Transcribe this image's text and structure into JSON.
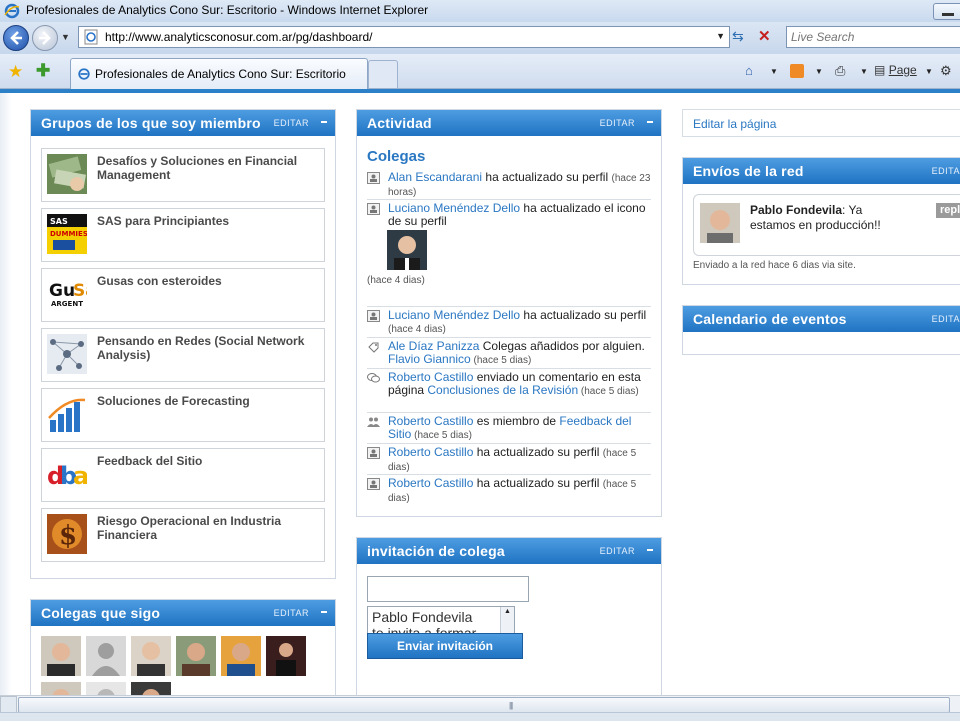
{
  "window": {
    "title": "Profesionales de Analytics Cono Sur: Escritorio - Windows Internet Explorer"
  },
  "address": {
    "url": "http://www.analyticsconosur.com.ar/pg/dashboard/",
    "search_placeholder": "Live Search"
  },
  "tabbar": {
    "tab_title": "Profesionales de Analytics Cono Sur: Escritorio",
    "page_label": "Page"
  },
  "groups_widget": {
    "title": "Grupos de los que soy miembro",
    "edit": "EDITAR",
    "items": [
      {
        "name": "Desafíos y Soluciones en Financial Management",
        "thumb": "money-thumb"
      },
      {
        "name": "SAS para Principiantes",
        "thumb": "sas-book-thumb",
        "thumb_text": "SAS DUMMIES"
      },
      {
        "name": "Gusas con esteroides",
        "thumb": "gusas-logo-thumb",
        "thumb_text": "GuSa",
        "thumb_sub": "ARGENT"
      },
      {
        "name": "Pensando en Redes (Social Network Analysis)",
        "thumb": "network-thumb"
      },
      {
        "name": "Soluciones de Forecasting",
        "thumb": "forecast-chart-thumb"
      },
      {
        "name": "Feedback del Sitio",
        "thumb": "feedback-logo-thumb",
        "thumb_text": "dba"
      },
      {
        "name": "Riesgo Operacional en Industria Financiera",
        "thumb": "dollar-thumb",
        "thumb_text": "$"
      }
    ]
  },
  "colegas_widget": {
    "title": "Colegas que sigo",
    "edit": "EDITAR"
  },
  "actividad_widget": {
    "title": "Actividad",
    "edit": "EDITAR",
    "subtitle": "Colegas",
    "entries": [
      {
        "icon": "profile-icon",
        "who": "Alan Escandarani",
        "text": " ha actualizado su perfil ",
        "when": "(hace 23 horas)"
      },
      {
        "icon": "profile-icon",
        "who": "Luciano Menéndez Dello",
        "text": " ha actualizado el icono de su perfil",
        "when": "(hace 4 dias)"
      },
      {
        "icon": "profile-icon",
        "who": "Luciano Menéndez Dello",
        "text": " ha actualizado su perfil ",
        "when": "(hace 4 dias)"
      },
      {
        "icon": "tag-icon",
        "who": "Ale Díaz Panizza",
        "text": " Colegas añadidos por alguien. ",
        "who2": "Flavio Giannico",
        "when": " (hace 5 dias)"
      },
      {
        "icon": "comment-icon",
        "who": "Roberto Castillo",
        "text": " enviado un comentario en esta página ",
        "who2": "Conclusiones de la Revisión",
        "when": " (hace 5 dias)"
      },
      {
        "icon": "group-icon",
        "who": "Roberto Castillo",
        "text": " es miembro de ",
        "who2": "Feedback del Sitio",
        "when": " (hace 5 dias)"
      },
      {
        "icon": "profile-icon",
        "who": "Roberto Castillo",
        "text": " ha actualizado su perfil ",
        "when": "(hace 5 dias)"
      },
      {
        "icon": "profile-icon",
        "who": "Roberto Castillo",
        "text": " ha actualizado su perfil ",
        "when": "(hace 5 dias)"
      }
    ]
  },
  "invitacion_widget": {
    "title": "invitación de colega",
    "edit": "EDITAR",
    "message": "Pablo Fondevila te invita a formar parte de",
    "button": "Enviar invitación"
  },
  "right": {
    "edit_page": "Editar la página",
    "envios": {
      "title": "Envíos de la red",
      "edit": "EDITAR",
      "author": "Pablo Fondevila",
      "message": ": Ya estamos en producción!!",
      "reply": "repl",
      "meta": "Enviado a la red hace 6 dias via site."
    },
    "calendario": {
      "title": "Calendario de eventos",
      "edit": "EDITAR"
    }
  }
}
